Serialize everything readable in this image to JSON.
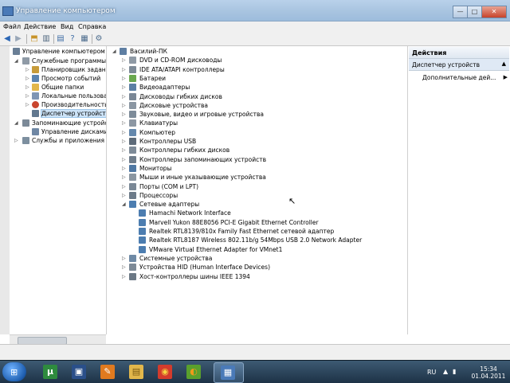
{
  "window": {
    "title": "Управление компьютером",
    "minimize": "—",
    "maximize": "□",
    "close": "✕"
  },
  "menu": [
    "Файл",
    "Действие",
    "Вид",
    "Справка"
  ],
  "left_tree": [
    {
      "label": "Управление компьютером (л",
      "toggle": "",
      "icon": "#6a7f96"
    },
    {
      "label": "Служебные программы",
      "toggle": "◢",
      "icon": "#8f9aa6"
    },
    {
      "label": "Планировщик заданий",
      "toggle": "▷",
      "icon": "#c79b3a"
    },
    {
      "label": "Просмотр событий",
      "toggle": "▷",
      "icon": "#5b84b1"
    },
    {
      "label": "Общие папки",
      "toggle": "▷",
      "icon": "#e2b74b"
    },
    {
      "label": "Локальные пользовате",
      "toggle": "▷",
      "icon": "#7e95b4"
    },
    {
      "label": "Производительность",
      "toggle": "▷",
      "icon": "#c9452e"
    },
    {
      "label": "Диспетчер устройств",
      "toggle": "",
      "icon": "#62788f"
    },
    {
      "label": "Запоминающие устройст",
      "toggle": "◢",
      "icon": "#7c8a98"
    },
    {
      "label": "Управление дисками",
      "toggle": "",
      "icon": "#6f87a4"
    },
    {
      "label": "Службы и приложения",
      "toggle": "▷",
      "icon": "#7d8f9f"
    }
  ],
  "device_tree": [
    {
      "label": "Василий-ПК",
      "toggle": "◢",
      "icon": "#5f7fa3"
    },
    {
      "label": "DVD и CD-ROM дисководы",
      "toggle": "▷",
      "icon": "#8f9aa5"
    },
    {
      "label": "IDE ATA/ATAPI контроллеры",
      "toggle": "▷",
      "icon": "#7d8a97"
    },
    {
      "label": "Батареи",
      "toggle": "▷",
      "icon": "#6aa84f"
    },
    {
      "label": "Видеоадаптеры",
      "toggle": "▷",
      "icon": "#5b7fa4"
    },
    {
      "label": "Дисководы гибких дисков",
      "toggle": "▷",
      "icon": "#7a8796"
    },
    {
      "label": "Дисковые устройства",
      "toggle": "▷",
      "icon": "#8a96a2"
    },
    {
      "label": "Звуковые, видео и игровые устройства",
      "toggle": "▷",
      "icon": "#7d8b99"
    },
    {
      "label": "Клавиатуры",
      "toggle": "▷",
      "icon": "#8c97a3"
    },
    {
      "label": "Компьютер",
      "toggle": "▷",
      "icon": "#6488ad"
    },
    {
      "label": "Контроллеры USB",
      "toggle": "▷",
      "icon": "#5d6b79"
    },
    {
      "label": "Контроллеры гибких дисков",
      "toggle": "▷",
      "icon": "#7e8b98"
    },
    {
      "label": "Контроллеры запоминающих устройств",
      "toggle": "▷",
      "icon": "#6f7d8b"
    },
    {
      "label": "Мониторы",
      "toggle": "▷",
      "icon": "#4f78a3"
    },
    {
      "label": "Мыши и иные указывающие устройства",
      "toggle": "▷",
      "icon": "#8b96a1"
    },
    {
      "label": "Порты (COM и LPT)",
      "toggle": "▷",
      "icon": "#7a8896"
    },
    {
      "label": "Процессоры",
      "toggle": "▷",
      "icon": "#6d7b89"
    },
    {
      "label": "Сетевые адаптеры",
      "toggle": "◢",
      "icon": "#4c7db0"
    },
    {
      "label": "Hamachi Network Interface",
      "toggle": "",
      "icon": "#4c7db0",
      "child": true
    },
    {
      "label": "Marvell Yukon 88E8056 PCI-E Gigabit Ethernet Controller",
      "toggle": "",
      "icon": "#4c7db0",
      "child": true
    },
    {
      "label": "Realtek RTL8139/810x Family Fast Ethernet сетевой адаптер",
      "toggle": "",
      "icon": "#4c7db0",
      "child": true
    },
    {
      "label": "Realtek RTL8187 Wireless 802.11b/g 54Mbps USB 2.0 Network Adapter",
      "toggle": "",
      "icon": "#4c7db0",
      "child": true
    },
    {
      "label": "VMware Virtual Ethernet Adapter for VMnet1",
      "toggle": "",
      "icon": "#4c7db0",
      "child": true
    },
    {
      "label": "Системные устройства",
      "toggle": "▷",
      "icon": "#6f8aa6"
    },
    {
      "label": "Устройства HID (Human Interface Devices)",
      "toggle": "▷",
      "icon": "#7d8a97"
    },
    {
      "label": "Хост-контроллеры шины IEEE 1394",
      "toggle": "▷",
      "icon": "#6b7885"
    }
  ],
  "actions": {
    "header": "Действия",
    "section": "Диспетчер устройств",
    "section_arrow": "▲",
    "item": "Дополнительные дей...",
    "item_arrow": "▶"
  },
  "tray": {
    "lang": "RU",
    "time": "15:34",
    "date": "01.04.2011"
  },
  "taskbar_buttons": [
    {
      "glyph": "µ",
      "bg": "#2e8b3e",
      "fg": "#ffffff"
    },
    {
      "glyph": "▣",
      "bg": "#2a4f8a",
      "fg": "#ffffff"
    },
    {
      "glyph": "✎",
      "bg": "#e07a1f",
      "fg": "#ffffff"
    },
    {
      "glyph": "▤",
      "bg": "#e2b74b",
      "fg": "#7a5a10"
    },
    {
      "glyph": "◉",
      "bg": "#d33b2c",
      "fg": "#f5d442"
    },
    {
      "glyph": "◐",
      "bg": "#5aa02c",
      "fg": "#f09a1a"
    },
    {
      "glyph": "▦",
      "bg": "#4a7ab8",
      "fg": "#ffffff"
    }
  ]
}
